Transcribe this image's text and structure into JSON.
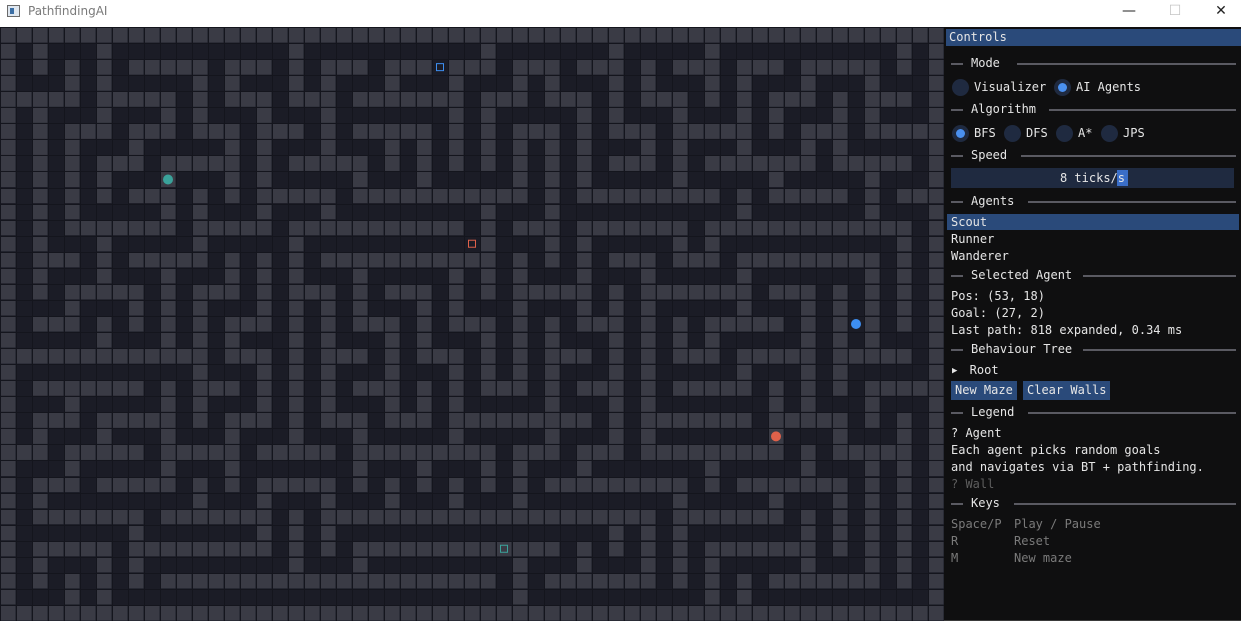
{
  "window": {
    "title": "PathfindingAI",
    "minimize_glyph": "—",
    "maximize_glyph": "☐",
    "close_glyph": "✕"
  },
  "panel": {
    "title": "Controls",
    "mode": {
      "header": "Mode",
      "options": [
        "Visualizer",
        "AI Agents"
      ],
      "selected": "AI Agents"
    },
    "algorithm": {
      "header": "Algorithm",
      "options": [
        "BFS",
        "DFS",
        "A*",
        "JPS"
      ],
      "selected": "BFS"
    },
    "speed": {
      "header": "Speed",
      "value_text": "8 ticks/s"
    },
    "agents": {
      "header": "Agents",
      "items": [
        "Scout",
        "Runner",
        "Wanderer"
      ],
      "selected": "Scout"
    },
    "selected_agent": {
      "header": "Selected Agent",
      "pos": "Pos:  (53, 18)",
      "goal": "Goal: (27, 2)",
      "last_path": "Last path: 818 expanded, 0.34 ms"
    },
    "behaviour_tree": {
      "header": "Behaviour Tree",
      "arrow": "▶",
      "root": "Root"
    },
    "buttons": {
      "new_maze": "New Maze",
      "clear_walls": "Clear Walls"
    },
    "legend": {
      "header": "Legend",
      "agent": "?   Agent",
      "line1": "Each agent picks random goals",
      "line2": "and navigates via BT + pathfinding.",
      "wall": "?   Wall"
    },
    "keys": {
      "header": "Keys",
      "rows": [
        {
          "key": "Space/P",
          "action": "Play / Pause"
        },
        {
          "key": "R",
          "action": "Reset"
        },
        {
          "key": "M",
          "action": "New maze"
        }
      ]
    }
  },
  "colors": {
    "wall": "#3a3b45",
    "floor": "#1b1c26",
    "accent": "#2a4a7a",
    "agent_teal": "#3aa29a",
    "agent_blue": "#3d8ef0",
    "agent_red": "#e0614a"
  },
  "maze_grid": {
    "cols": 59,
    "rows": 37,
    "agents": [
      {
        "color": "teal",
        "cell": [
          10,
          9
        ]
      },
      {
        "color": "blue",
        "cell": [
          53,
          18
        ]
      },
      {
        "color": "red",
        "cell": [
          48,
          25
        ]
      }
    ],
    "goals": [
      {
        "color": "blue",
        "cell": [
          27,
          2
        ]
      },
      {
        "color": "red",
        "cell": [
          29,
          13
        ]
      },
      {
        "color": "teal",
        "cell": [
          31,
          32
        ]
      }
    ]
  }
}
